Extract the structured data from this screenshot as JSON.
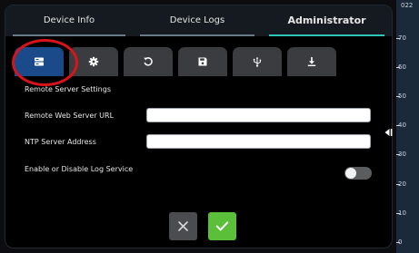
{
  "top_tabs": [
    {
      "label": "Device Info",
      "active": false
    },
    {
      "label": "Device Logs",
      "active": false
    },
    {
      "label": "Administrator",
      "active": true
    }
  ],
  "icon_tabs": [
    {
      "icon": "server-icon",
      "active": true
    },
    {
      "icon": "gear-icon",
      "active": false
    },
    {
      "icon": "reset-icon",
      "active": false
    },
    {
      "icon": "save-icon",
      "active": false
    },
    {
      "icon": "usb-icon",
      "active": false
    },
    {
      "icon": "download-icon",
      "active": false
    }
  ],
  "section_title": "Remote Server Settings",
  "fields": {
    "web_server_url": {
      "label": "Remote Web Server URL",
      "value": ""
    },
    "ntp_server": {
      "label": "NTP Server Address",
      "value": ""
    }
  },
  "log_service": {
    "label": "Enable or Disable Log Service",
    "enabled": false
  },
  "gauge": {
    "top_label": "022",
    "ticks": [
      "70",
      "60",
      "50",
      "40",
      "30",
      "20",
      "10",
      "0"
    ]
  },
  "colors": {
    "accent": "#2ec4b6",
    "active_tab": "#1a4a8a",
    "highlight": "#d8141a",
    "confirm": "#5bbf3a"
  }
}
